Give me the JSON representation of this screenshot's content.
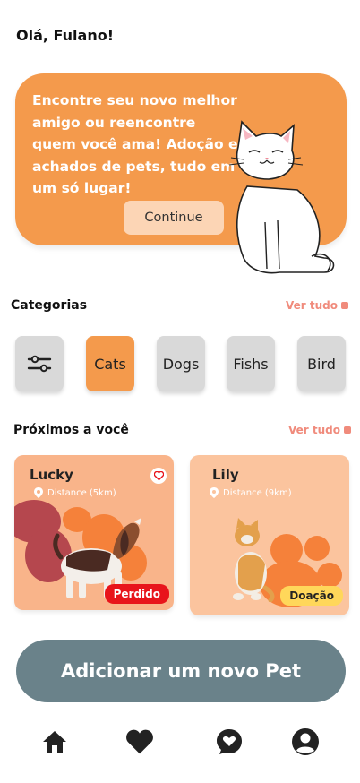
{
  "greeting": "Olá, Fulano!",
  "hero": {
    "text": "Encontre seu novo melhor amigo ou reencontre quem você ama! Adoção e achados de pets, tudo em um só lugar!",
    "button_label": "Continue"
  },
  "categories": {
    "title": "Categorias",
    "see_all": "Ver tudo",
    "items": [
      {
        "label": "",
        "icon": "filter-icon"
      },
      {
        "label": "Cats",
        "active": true
      },
      {
        "label": "Dogs"
      },
      {
        "label": "Fishs"
      },
      {
        "label": "Bird"
      }
    ]
  },
  "nearby": {
    "title": "Próximos a você",
    "see_all": "Ver tudo",
    "pets": [
      {
        "name": "Lucky",
        "distance": "Distance (5km)",
        "status": "Perdido",
        "status_color": "#E8141B"
      },
      {
        "name": "Lily",
        "distance": "Distance (9km)",
        "status": "Doação",
        "status_color": "#FFD75A"
      }
    ]
  },
  "add_pet_button": "Adicionar um novo Pet",
  "bottom_nav": [
    "home-icon",
    "heart-icon",
    "chat-heart-icon",
    "profile-icon"
  ],
  "colors": {
    "accent": "#F49A4C",
    "card": "#F9B48A",
    "primary_button": "#6A828A"
  }
}
